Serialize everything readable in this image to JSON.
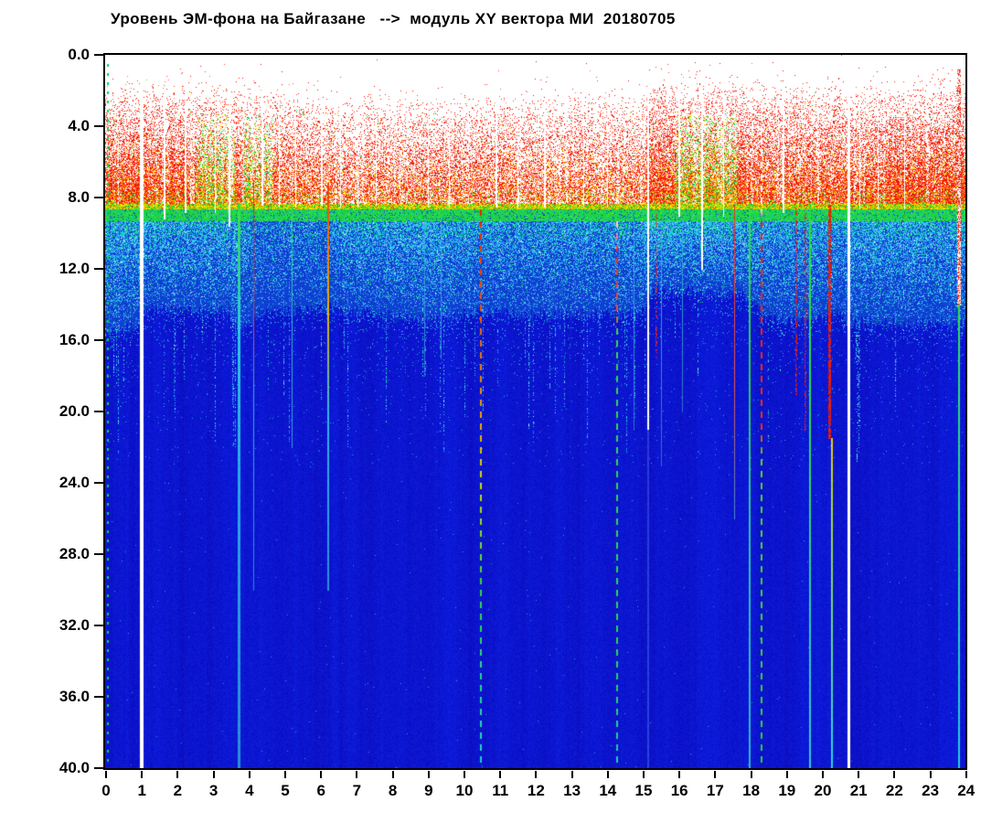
{
  "title": "Уровень ЭМ-фона на Байгазане   -->  модуль XY вектора МИ  20180705",
  "chart_data": {
    "type": "heatmap",
    "subtype": "spectrogram",
    "title": "Уровень ЭМ-фона на Байгазане   -->  модуль XY вектора МИ  20180705",
    "date": "20180705",
    "x_axis": {
      "range": [
        0,
        24
      ],
      "units": "hours",
      "ticks": [
        "0",
        "1",
        "2",
        "3",
        "4",
        "5",
        "6",
        "7",
        "8",
        "9",
        "10",
        "11",
        "12",
        "13",
        "14",
        "15",
        "16",
        "17",
        "18",
        "19",
        "20",
        "21",
        "22",
        "23",
        "24"
      ]
    },
    "y_axis": {
      "range": [
        0,
        40
      ],
      "direction": "down",
      "ticks": [
        "0.0",
        "4.0",
        "8.0",
        "12.0",
        "16.0",
        "20.0",
        "24.0",
        "28.0",
        "32.0",
        "36.0",
        "40.0"
      ]
    },
    "grid": false,
    "legend": false,
    "palette": {
      "white": "#ffffff",
      "reds": [
        "#f61400",
        "#ff3c20",
        "#e01010",
        "#ff6450"
      ],
      "yellows": [
        "#ffe800",
        "#ff9600"
      ],
      "greens": [
        "#22d822",
        "#00e064",
        "#78e61e"
      ],
      "band_lower_colors": [
        "#f5e300",
        "#2ad52a",
        "#ff9800",
        "#f02000"
      ],
      "band_green_colors": [
        "#1ed042",
        "#18c8a0",
        "#40f040"
      ],
      "cyans": [
        "#28c8f0",
        "#46a0ff",
        "#1edc78",
        "#b4f0fa"
      ],
      "blue_bg": "#1040d2",
      "deep_blue": "#0c16d0",
      "dot_cyan": "#2a9ae0"
    },
    "bands": [
      {
        "name": "white-top",
        "v": [
          0,
          2
        ],
        "desc": "white background, sparse red dots appear near onset"
      },
      {
        "name": "red-noise",
        "v": [
          2,
          8.3
        ],
        "desc": "dense red speckle, yellow/orange increasing with depth, green patches at 2.5-3.6h, 3.9-4.7h, 16-17.6h"
      },
      {
        "name": "yellow-green-transition",
        "v": [
          8.3,
          9.3
        ],
        "desc": "solid yellow-to-green transition band"
      },
      {
        "name": "cyan-speckle",
        "v": [
          9.3,
          14.6
        ],
        "desc": "cyan speckle on blue, density fades with depth, wavy lower edge 13-15.6"
      },
      {
        "name": "deep-blue",
        "v": [
          14.6,
          40
        ],
        "desc": "uniform deep blue with faint vertical banding and sparse cyan dots"
      }
    ],
    "model": {
      "onset_by_hour": [
        [
          0,
          2.0
        ],
        [
          3.8,
          2.1
        ],
        [
          5,
          2.5
        ],
        [
          6.5,
          2.9
        ],
        [
          9.5,
          2.7
        ],
        [
          14.8,
          2.6
        ],
        [
          15.3,
          1.7
        ],
        [
          18,
          1.8
        ],
        [
          19,
          2.0
        ],
        [
          21,
          2.1
        ],
        [
          24,
          1.9
        ]
      ],
      "density_by_hour": [
        [
          0,
          0.93
        ],
        [
          3.9,
          0.88
        ],
        [
          4.3,
          0.78
        ],
        [
          6.4,
          0.62
        ],
        [
          9,
          0.6
        ],
        [
          14.9,
          0.62
        ],
        [
          15.2,
          0.93
        ],
        [
          18.1,
          0.93
        ],
        [
          18.4,
          0.78
        ],
        [
          21,
          0.85
        ],
        [
          22,
          0.92
        ],
        [
          24,
          0.92
        ]
      ],
      "cyan_edge_by_hour": [
        [
          0,
          15.6
        ],
        [
          0.9,
          15.2
        ],
        [
          1.2,
          14.2
        ],
        [
          3.4,
          14.4
        ],
        [
          3.8,
          15.3
        ],
        [
          4.4,
          14.4
        ],
        [
          6.3,
          14.2
        ],
        [
          9,
          14.9
        ],
        [
          10.4,
          14.4
        ],
        [
          12,
          14.6
        ],
        [
          14.9,
          14.4
        ],
        [
          15.3,
          13.2
        ],
        [
          17.8,
          13.4
        ],
        [
          18.3,
          14.3
        ],
        [
          19,
          14.9
        ],
        [
          20.5,
          14.6
        ],
        [
          21,
          15.0
        ],
        [
          24,
          15.1
        ]
      ],
      "cyan_density_by_hour": [
        [
          0,
          1.0
        ],
        [
          3.6,
          0.95
        ],
        [
          4,
          0.6
        ],
        [
          6.2,
          0.6
        ],
        [
          6.6,
          0.85
        ],
        [
          9,
          1.0
        ],
        [
          10.4,
          0.85
        ],
        [
          14.8,
          0.85
        ],
        [
          15.1,
          1.15
        ],
        [
          18,
          1.0
        ],
        [
          19,
          0.9
        ],
        [
          21,
          0.95
        ],
        [
          24,
          0.95
        ]
      ],
      "green_patches_hours": [
        [
          2.55,
          3.6
        ],
        [
          3.85,
          4.65
        ],
        [
          15.9,
          17.6
        ]
      ]
    },
    "features": [
      {
        "t": 0.97,
        "type": "gap",
        "w": 4,
        "v": [
          1.0,
          40
        ]
      },
      {
        "t": 1.62,
        "type": "gap",
        "w": 2,
        "v": [
          1.8,
          9.2
        ]
      },
      {
        "t": 2.22,
        "type": "gap",
        "w": 2,
        "v": [
          1.8,
          8.8
        ]
      },
      {
        "t": 3.05,
        "type": "gap",
        "w": 1,
        "v": [
          2.0,
          8.8
        ]
      },
      {
        "t": 3.45,
        "type": "gap",
        "w": 2,
        "v": [
          1.5,
          9.6
        ]
      },
      {
        "t": 4.35,
        "type": "gap",
        "w": 2,
        "v": [
          1.5,
          8.4
        ]
      },
      {
        "t": 4.85,
        "type": "gap",
        "w": 1,
        "v": [
          2.0,
          8.5
        ]
      },
      {
        "t": 5.3,
        "type": "gap",
        "w": 1,
        "v": [
          2.0,
          8.5
        ]
      },
      {
        "t": 6.02,
        "type": "gap",
        "w": 2,
        "v": [
          1.5,
          8.4
        ]
      },
      {
        "t": 6.55,
        "type": "gap",
        "w": 1,
        "v": [
          2.0,
          8.5
        ]
      },
      {
        "t": 7.05,
        "type": "gap",
        "w": 1,
        "v": [
          2.0,
          8.5
        ]
      },
      {
        "t": 7.55,
        "type": "gap",
        "w": 1,
        "v": [
          2.3,
          8.4
        ]
      },
      {
        "t": 9.0,
        "type": "gap",
        "w": 1,
        "v": [
          2.5,
          8.5
        ]
      },
      {
        "t": 9.6,
        "type": "gap",
        "w": 1,
        "v": [
          2.5,
          8.5
        ]
      },
      {
        "t": 10.9,
        "type": "gap",
        "w": 2,
        "v": [
          2.5,
          8.5
        ]
      },
      {
        "t": 11.5,
        "type": "gap",
        "w": 1,
        "v": [
          2.5,
          8.5
        ]
      },
      {
        "t": 12.25,
        "type": "gap",
        "w": 2,
        "v": [
          2.5,
          8.5
        ]
      },
      {
        "t": 13.35,
        "type": "gap",
        "w": 1,
        "v": [
          2.5,
          8.5
        ]
      },
      {
        "t": 14.0,
        "type": "gap",
        "w": 1,
        "v": [
          2.5,
          8.5
        ]
      },
      {
        "t": 15.12,
        "type": "gap",
        "w": 2,
        "v": [
          1.2,
          21
        ]
      },
      {
        "t": 16.0,
        "type": "gap",
        "w": 2,
        "v": [
          1.2,
          9.0
        ]
      },
      {
        "t": 16.62,
        "type": "gap",
        "w": 2,
        "v": [
          1.5,
          12
        ]
      },
      {
        "t": 17.25,
        "type": "gap",
        "w": 1,
        "v": [
          1.5,
          9.0
        ]
      },
      {
        "t": 18.9,
        "type": "gap",
        "w": 2,
        "v": [
          1.5,
          8.8
        ]
      },
      {
        "t": 20.7,
        "type": "gap",
        "w": 3,
        "v": [
          1.0,
          40
        ]
      },
      {
        "t": 21.05,
        "type": "gap",
        "w": 1,
        "v": [
          2.0,
          8.6
        ]
      },
      {
        "t": 21.55,
        "type": "gap",
        "w": 1,
        "v": [
          2.0,
          8.6
        ]
      },
      {
        "t": 22.3,
        "type": "gap",
        "w": 1,
        "v": [
          2.2,
          8.6
        ]
      },
      {
        "t": 23.78,
        "type": "gap",
        "w": 4,
        "v": [
          0.8,
          14
        ]
      },
      {
        "t": 15.35,
        "type": "speckle",
        "w": 2,
        "v": [
          8.5,
          17
        ],
        "p": 0.35,
        "color": "#f02818"
      },
      {
        "t": 19.25,
        "type": "speckle",
        "w": 2,
        "v": [
          8.5,
          19
        ],
        "p": 0.45,
        "color": "#f02010"
      },
      {
        "t": 19.5,
        "type": "speckle",
        "w": 2,
        "v": [
          8.5,
          21
        ],
        "p": 0.4,
        "color": "#f02010"
      },
      {
        "t": 20.18,
        "type": "speckle",
        "w": 3,
        "v": [
          8.4,
          21.5
        ],
        "p": 0.8,
        "color": "#f01c00"
      },
      {
        "t": 23.78,
        "type": "speckle",
        "w": 4,
        "v": [
          0.8,
          14
        ],
        "p": 0.42,
        "color": "#f01c00"
      },
      {
        "t": 15.12,
        "type": "line",
        "w": 2,
        "stops": [
          [
            21,
            "#2a3ad8"
          ],
          [
            40,
            "#2a44dc"
          ]
        ]
      },
      {
        "t": 3.7,
        "type": "line",
        "w": 3,
        "stops": [
          [
            8.3,
            "#38e03c"
          ],
          [
            15.3,
            "#28cce0"
          ],
          [
            24,
            "#2aa8e8"
          ],
          [
            40,
            "#2a90dc"
          ]
        ]
      },
      {
        "t": 4.12,
        "type": "line",
        "w": 1,
        "stops": [
          [
            7.0,
            "#e62814"
          ],
          [
            14.3,
            "#e63822"
          ],
          [
            19,
            "#38b0e8"
          ],
          [
            30,
            "#2a88d8"
          ]
        ]
      },
      {
        "t": 5.2,
        "type": "line",
        "w": 1,
        "stops": [
          [
            8.4,
            "#30d860"
          ],
          [
            12,
            "#30c0d0"
          ],
          [
            22,
            "#3098e0"
          ]
        ]
      },
      {
        "t": 6.2,
        "type": "line",
        "w": 2,
        "stops": [
          [
            7.2,
            "#f04000"
          ],
          [
            12,
            "#f08c00"
          ],
          [
            14.6,
            "#e8b400"
          ],
          [
            20,
            "#30b8e8"
          ],
          [
            30,
            "#2a90d8"
          ]
        ]
      },
      {
        "t": 8.9,
        "type": "line",
        "w": 1,
        "stops": [
          [
            9.3,
            "#38b0e8"
          ],
          [
            18,
            "#2a80d0"
          ]
        ]
      },
      {
        "t": 9.35,
        "type": "line",
        "w": 1,
        "stops": [
          [
            9.3,
            "#38b0e8"
          ],
          [
            17,
            "#2a80d0"
          ]
        ]
      },
      {
        "t": 14.75,
        "type": "line",
        "w": 1,
        "stops": [
          [
            9.3,
            "#34b4ec"
          ],
          [
            21,
            "#2a70cc"
          ]
        ]
      },
      {
        "t": 15.5,
        "type": "line",
        "w": 1,
        "stops": [
          [
            9.3,
            "#34b4ec"
          ],
          [
            23,
            "#2a70cc"
          ]
        ]
      },
      {
        "t": 16.1,
        "type": "line",
        "w": 1,
        "stops": [
          [
            9.3,
            "#34b4ec"
          ],
          [
            20,
            "#2a70cc"
          ]
        ]
      },
      {
        "t": 17.55,
        "type": "line",
        "w": 1,
        "stops": [
          [
            8.5,
            "#f03424"
          ],
          [
            18.5,
            "#e85850"
          ],
          [
            26,
            "#3a90d8"
          ]
        ]
      },
      {
        "t": 17.95,
        "type": "line",
        "w": 2,
        "stops": [
          [
            8.3,
            "#28e038"
          ],
          [
            19,
            "#28d050"
          ],
          [
            26,
            "#28c8b0"
          ],
          [
            40,
            "#28b8d8"
          ]
        ]
      },
      {
        "t": 19.65,
        "type": "line",
        "w": 2,
        "stops": [
          [
            8.3,
            "#28e038"
          ],
          [
            24,
            "#28d868"
          ],
          [
            32,
            "#28ccc0"
          ],
          [
            40,
            "#30c8e0"
          ]
        ]
      },
      {
        "t": 20.25,
        "type": "line",
        "w": 2,
        "stops": [
          [
            21.5,
            "#f0c818"
          ],
          [
            24.5,
            "#b0dc28"
          ],
          [
            40,
            "#20d4f0"
          ]
        ]
      },
      {
        "t": 23.8,
        "type": "line",
        "w": 2,
        "stops": [
          [
            14,
            "#28e038"
          ],
          [
            16.2,
            "#30dc70"
          ],
          [
            40,
            "#28c8e8"
          ]
        ]
      },
      {
        "t": 10.45,
        "type": "dashes",
        "w": 2,
        "on": 7,
        "off": 6,
        "stops": [
          [
            8.4,
            "#f02000"
          ],
          [
            13,
            "#f04800"
          ],
          [
            20,
            "#f0a000"
          ],
          [
            24,
            "#cde000"
          ],
          [
            30,
            "#30d840"
          ],
          [
            37,
            "#22d8a0"
          ],
          [
            40,
            "#22ccd4"
          ]
        ]
      },
      {
        "t": 14.25,
        "type": "dashes",
        "w": 2,
        "on": 7,
        "off": 6,
        "stops": [
          [
            9.0,
            "#ffffff"
          ],
          [
            11,
            "#f02818"
          ],
          [
            14.5,
            "#f05030"
          ],
          [
            15.5,
            "#38d848"
          ],
          [
            34,
            "#28d848"
          ],
          [
            40,
            "#28c8c0"
          ]
        ]
      },
      {
        "t": 18.28,
        "type": "dashes",
        "w": 2,
        "on": 7,
        "off": 6,
        "stops": [
          [
            1.5,
            "#ffffff"
          ],
          [
            8.6,
            "#ffffff"
          ],
          [
            9.2,
            "#f02010"
          ],
          [
            21,
            "#f03010"
          ],
          [
            22.5,
            "#58d828"
          ],
          [
            40,
            "#28d048"
          ]
        ]
      },
      {
        "t": 0.05,
        "type": "dots",
        "w": 2,
        "v": [
          0.3,
          40
        ],
        "color": "#00d850"
      }
    ]
  }
}
